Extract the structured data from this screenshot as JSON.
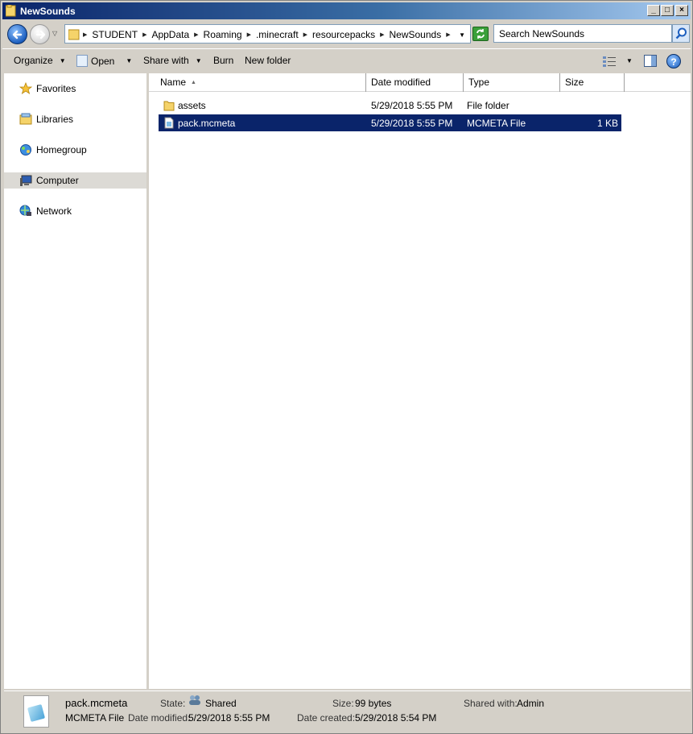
{
  "window": {
    "title": "NewSounds",
    "min_glyph": "_",
    "max_glyph": "□",
    "close_glyph": "×"
  },
  "address": {
    "crumbs": [
      "STUDENT",
      "AppData",
      "Roaming",
      ".minecraft",
      "resourcepacks",
      "NewSounds"
    ]
  },
  "search": {
    "value": "Search NewSounds"
  },
  "toolbar": {
    "organize": "Organize",
    "open": "Open",
    "share_with": "Share with",
    "burn": "Burn",
    "new_folder": "New folder",
    "help": "?"
  },
  "nav": {
    "items": [
      {
        "label": "Favorites",
        "icon": "star-icon"
      },
      {
        "label": "Libraries",
        "icon": "libraries-icon"
      },
      {
        "label": "Homegroup",
        "icon": "homegroup-icon"
      },
      {
        "label": "Computer",
        "icon": "computer-icon",
        "selected": true
      },
      {
        "label": "Network",
        "icon": "network-icon"
      }
    ]
  },
  "columns": {
    "name": "Name",
    "date_modified": "Date modified",
    "type": "Type",
    "size": "Size"
  },
  "files": [
    {
      "name": "assets",
      "date_modified": "5/29/2018 5:55 PM",
      "type": "File folder",
      "size": "",
      "icon": "folder-icon"
    },
    {
      "name": "pack.mcmeta",
      "date_modified": "5/29/2018 5:55 PM",
      "type": "MCMETA File",
      "size": "1 KB",
      "icon": "file-icon",
      "selected": true
    }
  ],
  "details": {
    "file_name": "pack.mcmeta",
    "file_type": "MCMETA File",
    "state_label": "State:",
    "state_value": "Shared",
    "size_label": "Size:",
    "size_value": "99 bytes",
    "shared_with_label": "Shared with:",
    "shared_with_value": "Admin",
    "date_modified_label": "Date modified:",
    "date_modified_value": "5/29/2018 5:55 PM",
    "date_created_label": "Date created:",
    "date_created_value": "5/29/2018 5:54 PM"
  },
  "colors": {
    "selection": "#0a246a",
    "titlebar_start": "#0a246a",
    "titlebar_end": "#a6caf0",
    "chrome": "#d4d0c8"
  }
}
